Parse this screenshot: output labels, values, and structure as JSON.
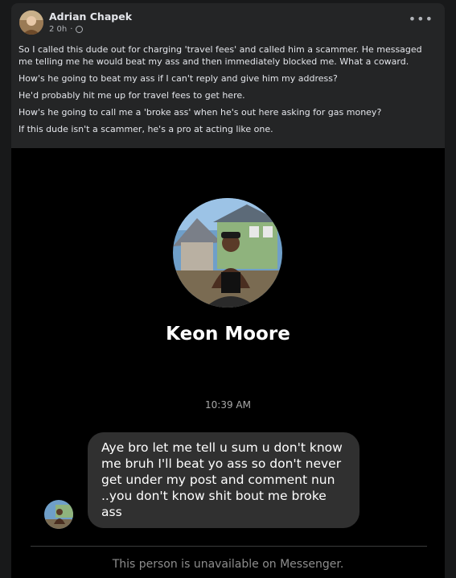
{
  "post": {
    "author": "Adrian Chapek",
    "time": "2 0h",
    "separator": "·",
    "more_label": "•••",
    "paragraphs": [
      "So I called this dude out for charging 'travel fees' and called him a scammer. He messaged me telling me he would beat my ass and then immediately blocked me. What a coward.",
      "How's he going to beat my ass if I can't reply and give him my address?",
      "He'd probably hit me up for travel fees to get here.",
      "How's he going to call me a 'broke ass' when he's out here asking for gas money?",
      "If this dude isn't a scammer, he's a pro at acting like one."
    ]
  },
  "screenshot": {
    "contact_name": "Keon Moore",
    "timestamp": "10:39 AM",
    "message": "Aye bro let me tell u sum u don't know me bruh I'll beat yo ass so don't never get under my post and comment nun ..you don't know shit bout me broke ass",
    "unavailable_text": "This person is unavailable on Messenger."
  },
  "icons": {
    "privacy": "globe-icon",
    "menu": "more-options-icon"
  },
  "colors": {
    "background": "#18191a",
    "card": "#242526",
    "bubble": "#303030",
    "text": "#e4e6eb",
    "muted": "#b0b3b8"
  }
}
